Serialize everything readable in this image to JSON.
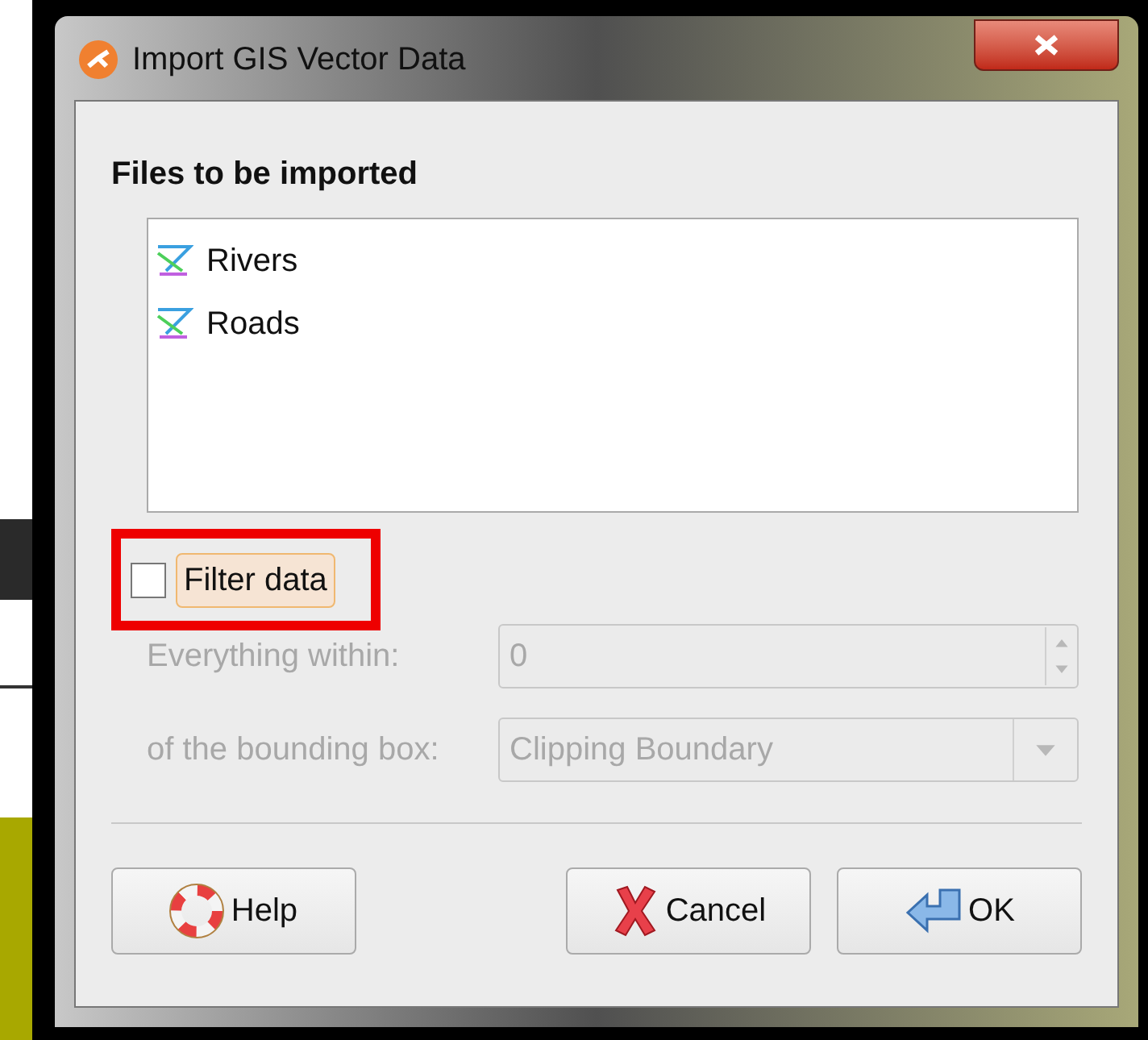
{
  "window": {
    "title": "Import GIS Vector Data"
  },
  "files": {
    "heading": "Files to be imported",
    "items": [
      {
        "name": "Rivers",
        "selected": false
      },
      {
        "name": "Roads",
        "selected": false
      }
    ]
  },
  "filter": {
    "label": "Filter data",
    "checked": false,
    "focused": true,
    "annotated": true
  },
  "within": {
    "label": "Everything within:",
    "value": "0",
    "disabled": true
  },
  "bounding": {
    "label": "of the bounding box:",
    "value": "Clipping Boundary",
    "disabled": true
  },
  "buttons": [
    {
      "kind": "help",
      "label": "Help"
    },
    {
      "kind": "cancel",
      "label": "Cancel"
    },
    {
      "kind": "ok",
      "label": "OK"
    }
  ]
}
